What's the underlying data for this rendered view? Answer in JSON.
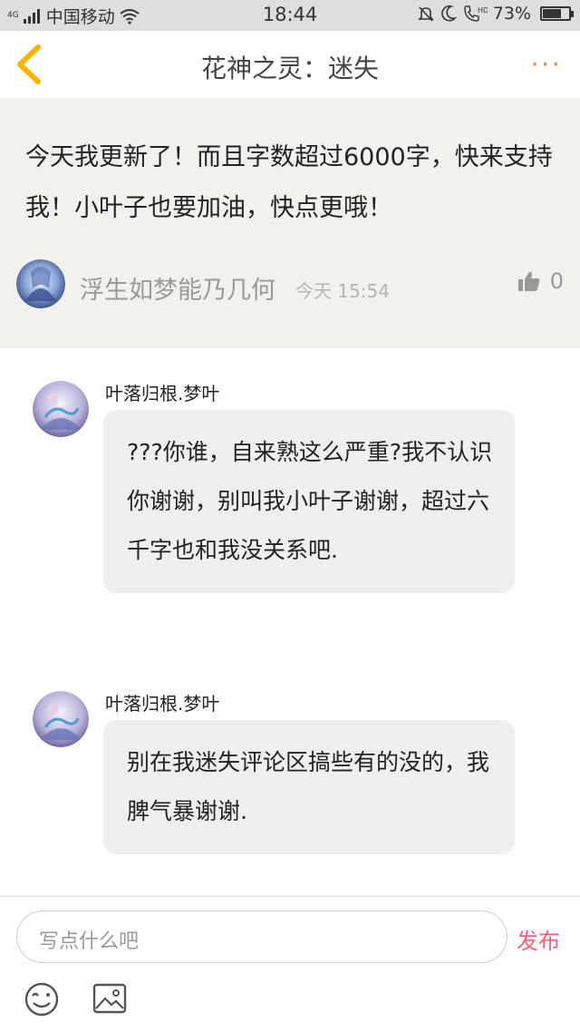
{
  "status_bar": {
    "network": "4G",
    "carrier": "中国移动",
    "time": "18:44",
    "battery_percent": "73%",
    "battery_level": 0.73,
    "hd": "HD"
  },
  "nav": {
    "title": "花神之灵：迷失",
    "more": "···"
  },
  "post": {
    "text": "今天我更新了！而且字数超过6000字，快来支持我！小叶子也要加油，快点更哦！",
    "author": "浮生如梦能乃几何",
    "time": "今天 15:54",
    "likes": "0"
  },
  "replies": [
    {
      "author": "叶落归根.梦叶",
      "text": "???你谁，自来熟这么严重?我不认识你谢谢，别叫我小叶子谢谢，超过六千字也和我没关系吧."
    },
    {
      "author": "叶落归根.梦叶",
      "text": "别在我迷失评论区搞些有的没的，我脾气暴谢谢."
    }
  ],
  "composer": {
    "placeholder": "写点什么吧",
    "send_label": "发布"
  },
  "colors": {
    "accent_orange": "#f0903a",
    "send_pink": "#f2607a",
    "post_bg": "#f1f2ee",
    "bubble_bg": "#efefef"
  }
}
